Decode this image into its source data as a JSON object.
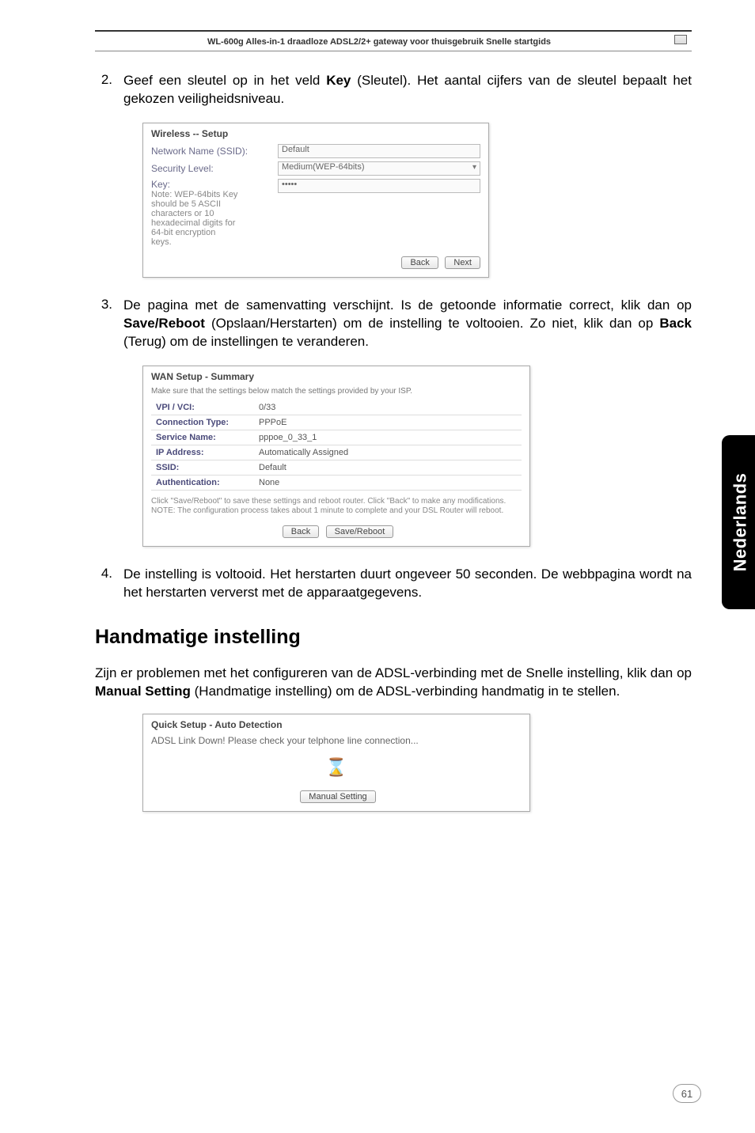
{
  "header": {
    "title": "WL-600g Alles-in-1 draadloze ADSL2/2+ gateway voor thuisgebruik Snelle startgids"
  },
  "step2": {
    "num": "2.",
    "text_before_bold": "Geef een sleutel op in het veld ",
    "bold": "Key",
    "text_after_bold": " (Sleutel). Het aantal cijfers van de sleutel bepaalt het gekozen veiligheidsniveau."
  },
  "screenshot1": {
    "title": "Wireless -- Setup",
    "ssid_label": "Network Name (SSID):",
    "ssid_value": "Default",
    "sec_label": "Security Level:",
    "sec_value": "Medium(WEP-64bits)",
    "key_label": "Key:",
    "key_value": "•••••",
    "note": "Note: WEP-64bits Key should be 5 ASCII characters or 10 hexadecimal digits for 64-bit encryption keys.",
    "back": "Back",
    "next": "Next"
  },
  "step3": {
    "num": "3.",
    "p1": "De pagina met de samenvatting verschijnt. Is de getoonde informatie correct, klik dan op ",
    "b1": "Save/Reboot",
    "p2": " (Opslaan/Herstarten) om de instelling te voltooien. Zo niet, klik dan op ",
    "b2": "Back",
    "p3": " (Terug) om de instellingen te veranderen."
  },
  "screenshot2": {
    "title": "WAN Setup - Summary",
    "subtitle": "Make sure that the settings below match the settings provided by your ISP.",
    "rows": [
      {
        "k": "VPI / VCI:",
        "v": "0/33"
      },
      {
        "k": "Connection Type:",
        "v": "PPPoE"
      },
      {
        "k": "Service Name:",
        "v": "pppoe_0_33_1"
      },
      {
        "k": "IP Address:",
        "v": "Automatically Assigned"
      },
      {
        "k": "SSID:",
        "v": "Default"
      },
      {
        "k": "Authentication:",
        "v": "None"
      }
    ],
    "note": "Click \"Save/Reboot\" to save these settings and reboot router. Click \"Back\" to make any modifications. NOTE: The configuration process takes about 1 minute to complete and your DSL Router will reboot.",
    "back": "Back",
    "save": "Save/Reboot"
  },
  "step4": {
    "num": "4.",
    "text": "De instelling is voltooid. Het herstarten duurt ongeveer 50 seconden. De webbpagina wordt na het herstarten ververst met de apparaatgegevens."
  },
  "section_heading": "Handmatige instelling",
  "para_manual": {
    "p1": "Zijn er problemen met het configureren van de ADSL-verbinding met de Snelle instelling, klik dan op ",
    "b1": "Manual Setting",
    "p2": " (Handmatige instelling) om de ADSL-verbinding handmatig in te stellen."
  },
  "screenshot3": {
    "title": "Quick Setup - Auto Detection",
    "line": "ADSL Link Down! Please check your telphone line connection...",
    "btn": "Manual Setting"
  },
  "side_tab": "Nederlands",
  "page_number": "61"
}
